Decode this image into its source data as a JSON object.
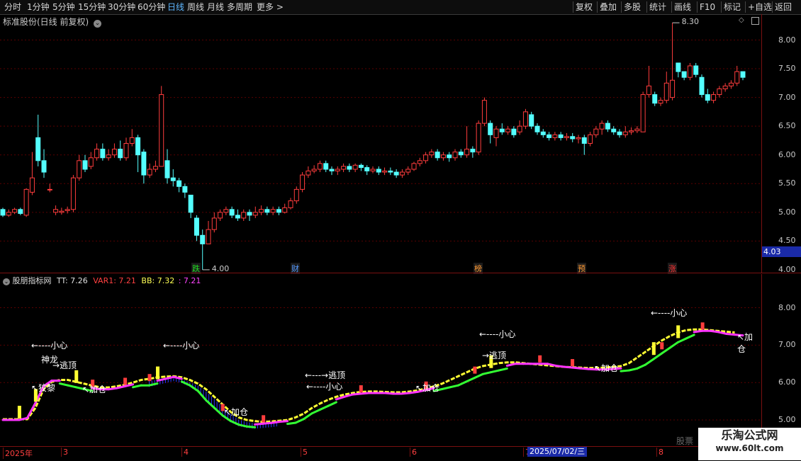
{
  "toolbar": {
    "periods": [
      "分时",
      "1分钟",
      "5分钟",
      "15分钟",
      "30分钟",
      "60分钟",
      "日线",
      "周线",
      "月线",
      "多周期",
      "更多 >"
    ],
    "active": "日线",
    "tools": [
      "复权",
      "叠加",
      "多股",
      "统计",
      "画线",
      "F10",
      "标记",
      "+自选",
      "返回"
    ]
  },
  "main": {
    "title": "标准股份(日线 前复权)",
    "price_tag": "4.03",
    "high_label": "8.30",
    "low_label": "4.00",
    "events": [
      {
        "text": "跌",
        "color": "#22dd22"
      },
      {
        "text": "财",
        "color": "#5599ff"
      },
      {
        "text": "榜",
        "color": "#ff9933"
      },
      {
        "text": "预",
        "color": "#ff9933"
      },
      {
        "text": "涨",
        "color": "#ff3333"
      }
    ],
    "yticks": [
      "8.00",
      "7.50",
      "7.00",
      "6.50",
      "6.00",
      "5.50",
      "5.00",
      "4.50",
      "4.00"
    ]
  },
  "indicator": {
    "name": "股朋指标网",
    "tt": "TT: 7.26",
    "var1": "VAR1: 7.21",
    "bb": "BB: 7.32",
    "last": ": 7.21",
    "yticks": [
      "8.00",
      "7.00",
      "6.00",
      "5.00"
    ],
    "labels": [
      "←----小心",
      "神龙",
      "→逃顶",
      "↖狡黎",
      "↖加仓",
      "←----小心",
      "↖加仓",
      "←---→逃顶",
      "←----小心",
      "↖加仓",
      "←----小心",
      "→逃顶",
      "↖加仓",
      "←----小心",
      "↖加仓"
    ]
  },
  "xaxis": {
    "labels": [
      "2025年",
      "3",
      "4",
      "5",
      "6",
      "7",
      "8"
    ],
    "cursor_date": "2025/07/02/三"
  },
  "watermark": {
    "brand": "乐淘公式网",
    "url": "www.60lt.com",
    "corner": "股票"
  },
  "colors": {
    "up": "#ff3d3d",
    "down": "#54ffff",
    "magenta": "#ff33ff",
    "yellow": "#ffff33",
    "green": "#33ff33",
    "axis": "#7a1010",
    "grid": "#5a0000"
  },
  "chart_data": {
    "type": "candlestick",
    "title": "标准股份(日线 前复权)",
    "ylim": [
      4.0,
      8.35
    ],
    "xlabels": [
      "2025年",
      "3",
      "4",
      "5",
      "6",
      "7",
      "8"
    ],
    "candles": [
      [
        5.05,
        4.95,
        5.08,
        4.92
      ],
      [
        4.95,
        5.0,
        5.05,
        4.92
      ],
      [
        5.0,
        5.05,
        5.08,
        4.97
      ],
      [
        5.05,
        4.98,
        5.08,
        4.95
      ],
      [
        4.95,
        5.4,
        5.42,
        4.92
      ],
      [
        5.35,
        5.6,
        6.05,
        5.3
      ],
      [
        6.3,
        5.9,
        6.7,
        5.8
      ],
      [
        5.9,
        5.7,
        6.1,
        5.6
      ],
      [
        5.4,
        5.4,
        5.5,
        5.35
      ],
      [
        5.0,
        5.05,
        5.12,
        4.95
      ],
      [
        5.0,
        5.02,
        5.08,
        4.96
      ],
      [
        5.03,
        5.05,
        5.1,
        4.98
      ],
      [
        5.05,
        5.6,
        5.65,
        5.0
      ],
      [
        5.6,
        5.9,
        6.0,
        5.55
      ],
      [
        5.9,
        5.75,
        6.0,
        5.7
      ],
      [
        5.8,
        5.95,
        6.05,
        5.75
      ],
      [
        5.95,
        6.1,
        6.2,
        5.9
      ],
      [
        6.1,
        5.95,
        6.2,
        5.9
      ],
      [
        5.95,
        6.0,
        6.1,
        5.9
      ],
      [
        6.0,
        6.1,
        6.2,
        5.95
      ],
      [
        6.1,
        5.95,
        6.25,
        5.9
      ],
      [
        5.95,
        6.2,
        6.3,
        5.9
      ],
      [
        6.2,
        6.3,
        6.45,
        6.15
      ],
      [
        6.3,
        6.0,
        6.35,
        5.7
      ],
      [
        6.05,
        5.65,
        6.1,
        5.5
      ],
      [
        5.65,
        5.75,
        5.85,
        5.6
      ],
      [
        5.75,
        5.8,
        5.9,
        5.7
      ],
      [
        5.8,
        7.05,
        7.2,
        5.8
      ],
      [
        5.9,
        5.6,
        6.1,
        5.5
      ],
      [
        5.6,
        5.55,
        5.75,
        5.45
      ],
      [
        5.55,
        5.45,
        5.6,
        5.35
      ],
      [
        5.45,
        5.35,
        5.5,
        5.25
      ],
      [
        5.3,
        5.0,
        5.3,
        4.9
      ],
      [
        4.9,
        4.6,
        4.95,
        4.5
      ],
      [
        4.6,
        4.45,
        4.7,
        4.0
      ],
      [
        4.45,
        4.7,
        4.85,
        4.45
      ],
      [
        4.7,
        4.9,
        5.0,
        4.65
      ],
      [
        4.9,
        5.0,
        5.05,
        4.85
      ],
      [
        5.0,
        5.05,
        5.1,
        4.95
      ],
      [
        5.05,
        4.95,
        5.1,
        4.9
      ],
      [
        4.95,
        4.9,
        5.05,
        4.85
      ],
      [
        4.9,
        5.0,
        5.05,
        4.85
      ],
      [
        5.0,
        4.95,
        5.05,
        4.85
      ],
      [
        4.95,
        5.0,
        5.1,
        4.9
      ],
      [
        5.0,
        5.05,
        5.12,
        4.95
      ],
      [
        5.05,
        5.0,
        5.1,
        4.95
      ],
      [
        5.0,
        5.05,
        5.1,
        4.95
      ],
      [
        5.05,
        5.0,
        5.1,
        4.95
      ],
      [
        5.0,
        5.08,
        5.15,
        4.98
      ],
      [
        5.08,
        5.2,
        5.25,
        5.05
      ],
      [
        5.2,
        5.4,
        5.45,
        5.15
      ],
      [
        5.4,
        5.65,
        5.7,
        5.35
      ],
      [
        5.65,
        5.72,
        5.8,
        5.6
      ],
      [
        5.72,
        5.75,
        5.82,
        5.68
      ],
      [
        5.75,
        5.85,
        5.9,
        5.7
      ],
      [
        5.85,
        5.75,
        5.9,
        5.7
      ],
      [
        5.75,
        5.72,
        5.8,
        5.65
      ],
      [
        5.72,
        5.75,
        5.8,
        5.65
      ],
      [
        5.75,
        5.8,
        5.85,
        5.7
      ],
      [
        5.8,
        5.75,
        5.85,
        5.7
      ],
      [
        5.75,
        5.82,
        5.85,
        5.7
      ],
      [
        5.82,
        5.78,
        5.85,
        5.72
      ],
      [
        5.78,
        5.72,
        5.82,
        5.65
      ],
      [
        5.72,
        5.75,
        5.8,
        5.68
      ],
      [
        5.75,
        5.7,
        5.8,
        5.65
      ],
      [
        5.7,
        5.72,
        5.78,
        5.65
      ],
      [
        5.72,
        5.7,
        5.78,
        5.65
      ],
      [
        5.7,
        5.65,
        5.75,
        5.6
      ],
      [
        5.65,
        5.7,
        5.75,
        5.6
      ],
      [
        5.7,
        5.75,
        5.8,
        5.65
      ],
      [
        5.75,
        5.85,
        5.88,
        5.72
      ],
      [
        5.85,
        5.9,
        5.95,
        5.8
      ],
      [
        5.9,
        6.0,
        6.05,
        5.85
      ],
      [
        6.0,
        6.05,
        6.1,
        5.95
      ],
      [
        6.05,
        5.95,
        6.1,
        5.9
      ],
      [
        5.95,
        6.0,
        6.05,
        5.9
      ],
      [
        6.0,
        5.95,
        6.05,
        5.88
      ],
      [
        5.95,
        6.05,
        6.1,
        5.9
      ],
      [
        6.05,
        6.0,
        6.1,
        5.95
      ],
      [
        6.0,
        6.1,
        6.5,
        5.95
      ],
      [
        6.1,
        6.05,
        6.15,
        5.95
      ],
      [
        6.05,
        6.55,
        6.6,
        6.0
      ],
      [
        6.55,
        6.95,
        7.0,
        6.5
      ],
      [
        6.55,
        6.35,
        6.6,
        6.2
      ],
      [
        6.3,
        6.45,
        6.5,
        6.15
      ],
      [
        6.45,
        6.4,
        6.55,
        6.35
      ],
      [
        6.4,
        6.45,
        6.5,
        6.35
      ],
      [
        6.45,
        6.35,
        6.5,
        6.3
      ],
      [
        6.4,
        6.5,
        6.6,
        6.35
      ],
      [
        6.5,
        6.75,
        6.8,
        6.45
      ],
      [
        6.7,
        6.5,
        6.75,
        6.45
      ],
      [
        6.5,
        6.4,
        6.55,
        6.35
      ],
      [
        6.4,
        6.35,
        6.45,
        6.3
      ],
      [
        6.35,
        6.3,
        6.4,
        6.25
      ],
      [
        6.3,
        6.35,
        6.4,
        6.25
      ],
      [
        6.35,
        6.3,
        6.4,
        6.25
      ],
      [
        6.3,
        6.32,
        6.38,
        6.25
      ],
      [
        6.32,
        6.28,
        6.38,
        6.22
      ],
      [
        6.28,
        6.3,
        6.35,
        6.2
      ],
      [
        6.3,
        6.2,
        6.35,
        6.0
      ],
      [
        6.2,
        6.35,
        6.4,
        6.15
      ],
      [
        6.35,
        6.45,
        6.5,
        6.3
      ],
      [
        6.45,
        6.55,
        6.6,
        6.35
      ],
      [
        6.55,
        6.45,
        6.6,
        6.4
      ],
      [
        6.45,
        6.4,
        6.5,
        6.35
      ],
      [
        6.4,
        6.35,
        6.45,
        6.3
      ],
      [
        6.35,
        6.4,
        6.5,
        6.3
      ],
      [
        6.4,
        6.42,
        6.48,
        6.35
      ],
      [
        6.42,
        6.45,
        6.5,
        6.38
      ],
      [
        6.4,
        7.05,
        7.1,
        6.4
      ],
      [
        7.05,
        7.2,
        7.55,
        7.0
      ],
      [
        7.05,
        6.9,
        7.1,
        6.85
      ],
      [
        6.9,
        6.95,
        7.0,
        6.85
      ],
      [
        6.95,
        7.25,
        7.45,
        6.9
      ],
      [
        7.0,
        7.3,
        8.3,
        6.95
      ],
      [
        7.6,
        7.45,
        7.5,
        7.35
      ],
      [
        7.45,
        7.35,
        7.45,
        7.3
      ],
      [
        7.35,
        7.55,
        7.6,
        7.3
      ],
      [
        7.55,
        7.4,
        7.6,
        7.35
      ],
      [
        7.35,
        7.05,
        7.4,
        7.0
      ],
      [
        7.05,
        6.95,
        7.15,
        6.9
      ],
      [
        6.95,
        7.05,
        7.1,
        6.9
      ],
      [
        7.05,
        7.15,
        7.2,
        7.0
      ],
      [
        7.15,
        7.2,
        7.25,
        7.1
      ],
      [
        7.2,
        7.25,
        7.3,
        7.15
      ],
      [
        7.25,
        7.45,
        7.55,
        7.2
      ],
      [
        7.45,
        7.35,
        7.45,
        7.3
      ]
    ],
    "indicator": {
      "tt": [
        5.0,
        5.0,
        5.0,
        5.05,
        5.45,
        5.9,
        6.05,
        6.05,
        6.0,
        5.95,
        5.9,
        5.85,
        5.82,
        5.82,
        5.85,
        5.9,
        5.95,
        6.0,
        6.0,
        6.05,
        6.1,
        6.15,
        6.1,
        6.0,
        5.85,
        5.6,
        5.4,
        5.2,
        5.05,
        4.95,
        4.9,
        4.88,
        4.9,
        4.92,
        4.95,
        4.97,
        5.0,
        5.1,
        5.25,
        5.35,
        5.45,
        5.55,
        5.62,
        5.68,
        5.7,
        5.72,
        5.72,
        5.72,
        5.7,
        5.7,
        5.72,
        5.75,
        5.8,
        5.85,
        5.9,
        5.95,
        6.0,
        6.1,
        6.2,
        6.3,
        6.35,
        6.4,
        6.45,
        6.5,
        6.5,
        6.5,
        6.5,
        6.5,
        6.45,
        6.42,
        6.4,
        6.38,
        6.36,
        6.35,
        6.35,
        6.36,
        6.38,
        6.4,
        6.45,
        6.55,
        6.7,
        6.85,
        7.0,
        7.15,
        7.25,
        7.35,
        7.38,
        7.38,
        7.35,
        7.3,
        7.28,
        7.26
      ],
      "bb": [
        5.0,
        5.0,
        5.0,
        5.0,
        5.3,
        5.8,
        6.0,
        6.05,
        6.05,
        6.0,
        5.95,
        5.9,
        5.85,
        5.85,
        5.88,
        5.92,
        5.98,
        6.05,
        6.08,
        6.12,
        6.14,
        6.15,
        6.12,
        6.05,
        5.95,
        5.8,
        5.6,
        5.4,
        5.2,
        5.05,
        4.98,
        4.95,
        4.93,
        4.94,
        4.96,
        4.98,
        5.05,
        5.15,
        5.3,
        5.42,
        5.52,
        5.6,
        5.66,
        5.7,
        5.73,
        5.74,
        5.74,
        5.73,
        5.72,
        5.72,
        5.74,
        5.77,
        5.82,
        5.88,
        5.95,
        6.05,
        6.15,
        6.25,
        6.35,
        6.42,
        6.46,
        6.5,
        6.52,
        6.52,
        6.5,
        6.48,
        6.46,
        6.44,
        6.42,
        6.4,
        6.39,
        6.38,
        6.37,
        6.37,
        6.38,
        6.4,
        6.42,
        6.5,
        6.65,
        6.8,
        6.95,
        7.1,
        7.22,
        7.32,
        7.38,
        7.4,
        7.4,
        7.38,
        7.36,
        7.34,
        7.32
      ]
    }
  }
}
